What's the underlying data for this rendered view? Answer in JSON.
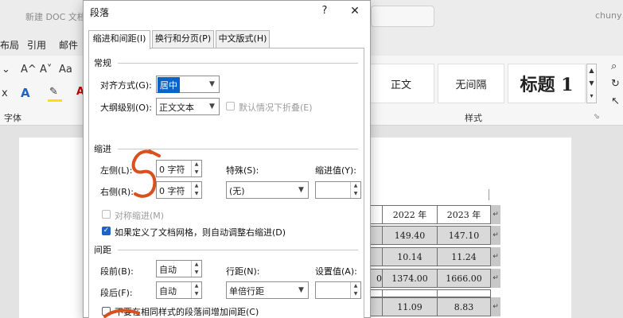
{
  "word": {
    "doc_title": "新建 DOC 文档",
    "user": "chuny",
    "tabs": [
      "布局",
      "引用",
      "邮件"
    ],
    "font_group_label": "字体",
    "styles_group_label": "样式",
    "styles": [
      "正文",
      "无间隔",
      "标题 1"
    ],
    "font_glyphs": [
      "A^",
      "A˅",
      "Aa"
    ],
    "table_rows": [
      {
        "c1": "2022 年",
        "c2": "2023 年",
        "shade": false
      },
      {
        "c1": "149.40",
        "c2": "147.10",
        "shade": true
      },
      {
        "c1": "10.14",
        "c2": "11.24",
        "shade": true
      },
      {
        "c1": "1374.00",
        "c2": "1666.00",
        "shade": true
      },
      {
        "c1": "",
        "c2": "",
        "shade": false
      },
      {
        "c1": "11.09",
        "c2": "8.83",
        "shade": true
      }
    ],
    "row_marker": "↵",
    "left_stub": "0"
  },
  "dialog": {
    "title": "段落",
    "help": "?",
    "close": "✕",
    "tabs": [
      "缩进和间距(I)",
      "换行和分页(P)",
      "中文版式(H)"
    ],
    "general": {
      "header": "常规",
      "align_label": "对齐方式(G):",
      "align_value": "居中",
      "outline_label": "大纲级别(O):",
      "outline_value": "正文文本",
      "collapse_label": "默认情况下折叠(E)"
    },
    "indent": {
      "header": "缩进",
      "left_label": "左侧(L):",
      "left_value": "0 字符",
      "right_label": "右侧(R):",
      "right_value": "0 字符",
      "special_label": "特殊(S):",
      "special_value": "(无)",
      "indent_value_label": "缩进值(Y):",
      "mirror_label": "对称缩进(M)",
      "auto_adjust_label": "如果定义了文档网格，则自动调整右缩进(D)"
    },
    "spacing": {
      "header": "间距",
      "before_label": "段前(B):",
      "before_value": "自动",
      "after_label": "段后(F):",
      "after_value": "自动",
      "line_label": "行距(N):",
      "line_value": "单倍行距",
      "at_label": "设置值(A):",
      "no_space_label": "不要在相同样式的段落间增加间距(C)"
    }
  },
  "colors": {
    "accent": "#1f63c4",
    "annotation": "#d9501e",
    "selection": "#0a64c8"
  }
}
